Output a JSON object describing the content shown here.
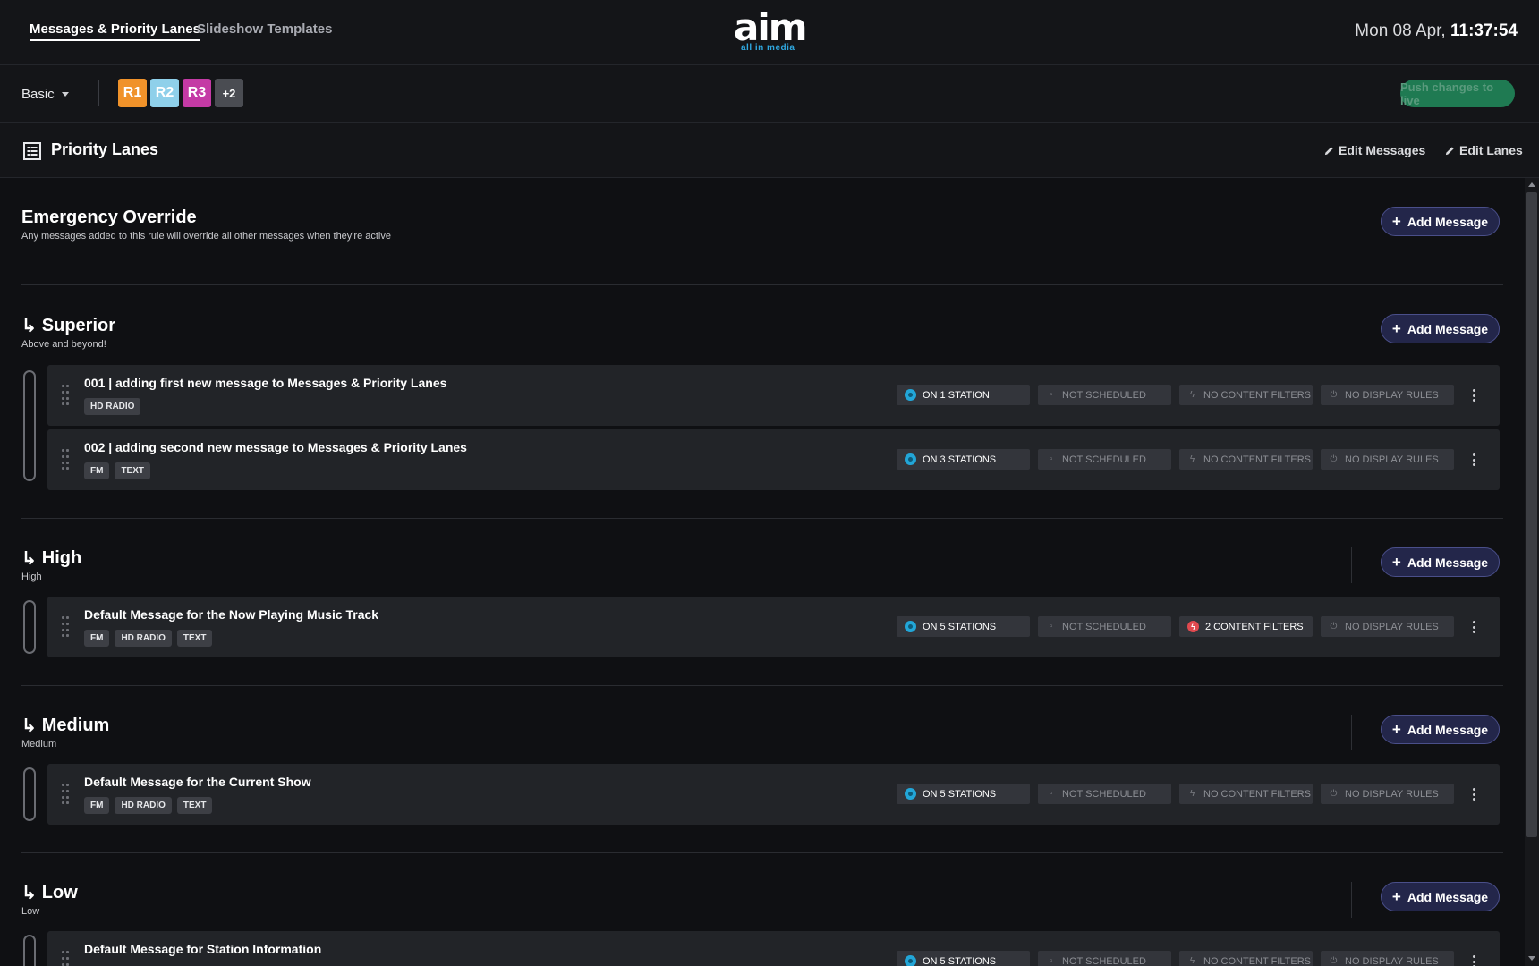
{
  "nav": {
    "tabs": [
      {
        "label": "Messages & Priority Lanes",
        "active": true
      },
      {
        "label": "Slideshow Templates",
        "active": false
      }
    ]
  },
  "logo": {
    "word": "aim",
    "tagline": "all in media"
  },
  "clock": {
    "date": "Mon 08 Apr,",
    "time": "11:37:54"
  },
  "toolbar": {
    "view_select": "Basic",
    "rules": [
      {
        "label": "R1",
        "color": "#f0922a"
      },
      {
        "label": "R2",
        "color": "#8fd0ea"
      },
      {
        "label": "R3",
        "color": "#c43aa5"
      },
      {
        "label": "+2",
        "color": "#4a4c52"
      }
    ],
    "push_label": "Push changes to live"
  },
  "section": {
    "title": "Priority Lanes",
    "edit_messages": "Edit Messages",
    "edit_lanes": "Edit Lanes"
  },
  "add_message_label": "Add Message",
  "lanes": [
    {
      "title": "Emergency Override",
      "subtitle": "Any messages added to this rule will override all other messages when they're active",
      "messages": []
    },
    {
      "title": "Superior",
      "subtitle": "Above and beyond!",
      "messages": [
        {
          "title": "001 | adding first new message to Messages & Priority Lanes",
          "tags": [
            "HD RADIO"
          ],
          "stations": "ON 1 STATION",
          "schedule": "NOT SCHEDULED",
          "filters": "NO CONTENT FILTERS",
          "display": "NO DISPLAY RULES"
        },
        {
          "title": "002 | adding second new message to Messages & Priority Lanes",
          "tags": [
            "FM",
            "TEXT"
          ],
          "stations": "ON 3 STATIONS",
          "schedule": "NOT SCHEDULED",
          "filters": "NO CONTENT FILTERS",
          "display": "NO DISPLAY RULES"
        }
      ]
    },
    {
      "title": "High",
      "subtitle": "High",
      "messages": [
        {
          "title": "Default Message for the Now Playing Music Track",
          "tags": [
            "FM",
            "HD RADIO",
            "TEXT"
          ],
          "stations": "ON 5 STATIONS",
          "schedule": "NOT SCHEDULED",
          "filters": "2 CONTENT FILTERS",
          "display": "NO DISPLAY RULES"
        }
      ]
    },
    {
      "title": "Medium",
      "subtitle": "Medium",
      "messages": [
        {
          "title": "Default Message for the Current Show",
          "tags": [
            "FM",
            "HD RADIO",
            "TEXT"
          ],
          "stations": "ON 5 STATIONS",
          "schedule": "NOT SCHEDULED",
          "filters": "NO CONTENT FILTERS",
          "display": "NO DISPLAY RULES"
        }
      ]
    },
    {
      "title": "Low",
      "subtitle": "Low",
      "messages": [
        {
          "title": "Default Message for Station Information",
          "tags": [],
          "stations": "ON 5 STATIONS",
          "schedule": "NOT SCHEDULED",
          "filters": "NO CONTENT FILTERS",
          "display": "NO DISPLAY RULES"
        }
      ]
    }
  ]
}
